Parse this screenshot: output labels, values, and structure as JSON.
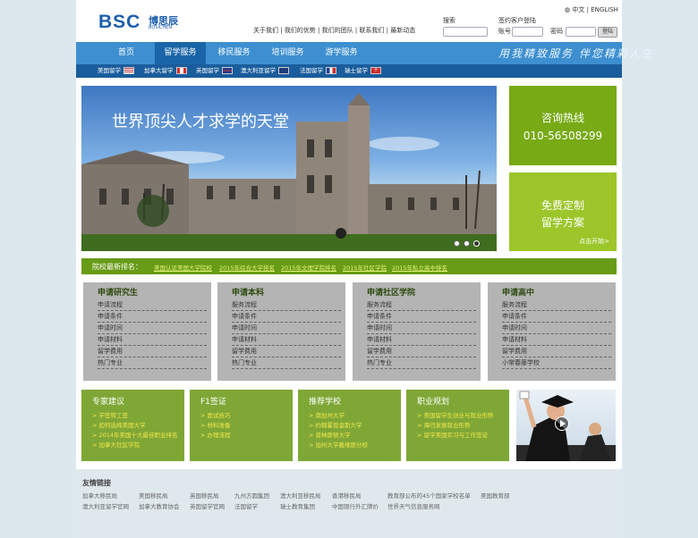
{
  "logo": {
    "mark": "BSC",
    "cn": "博思辰",
    "en": "BOSICHEN"
  },
  "top_links": [
    "关于我们",
    "我们的优势",
    "我们的团队",
    "联系我们",
    "最新动态"
  ],
  "lang": {
    "cn": "中文",
    "sep": "|",
    "en": "ENGLISH"
  },
  "search_label": "搜索",
  "login": {
    "title": "签约客户登陆",
    "account": "账号",
    "password": "密码",
    "button": "登陆"
  },
  "nav": [
    "首页",
    "留学服务",
    "移民服务",
    "培训服务",
    "游学服务"
  ],
  "slogan": "用我精致服务 伴您精彩人生",
  "subnav": [
    "美国留学",
    "加拿大留学",
    "英国留学",
    "澳大利亚留学",
    "法国留学",
    "瑞士留学"
  ],
  "flag_colors": [
    "#bf3a46",
    "#d42a2a",
    "#1d3c8c",
    "#1e3a7a",
    "#1e3c96",
    "#d42a2a"
  ],
  "banner": {
    "title": "世界顶尖人才求学的天堂"
  },
  "hotline": {
    "title": "咨询热线",
    "number": "010-56508299"
  },
  "custom": {
    "line1": "免费定制",
    "line2": "留学方案",
    "cta": "点击开始>"
  },
  "ranking": {
    "title": "院校最新排名：",
    "links": [
      "美国认证美国大学院校",
      "2015年综合大学排名",
      "2015年文理学院排名",
      "2015年社区学院",
      "2015年私立高中排名"
    ]
  },
  "categories": [
    {
      "title": "申请研究生",
      "items": [
        "申请流程",
        "申请条件",
        "申请时间",
        "申请材料",
        "留学费用",
        "热门专业"
      ]
    },
    {
      "title": "申请本科",
      "items": [
        "服务流程",
        "申请条件",
        "申请时间",
        "申请材料",
        "留学费用",
        "热门专业"
      ]
    },
    {
      "title": "申请社区学院",
      "items": [
        "服务流程",
        "申请条件",
        "申请时间",
        "申请材料",
        "留学费用",
        "热门专业"
      ]
    },
    {
      "title": "申请高中",
      "items": [
        "服务流程",
        "申请条件",
        "申请时间",
        "申请材料",
        "留学费用",
        "小常春藤学校"
      ]
    }
  ],
  "panels": [
    {
      "title": "专家建议",
      "items": [
        "> 学签转工签",
        "> 如何选择美国大学",
        "> 2014年美国十大最佳职业排名",
        "> 加拿大社区学院"
      ]
    },
    {
      "title": "F1签证",
      "items": [
        "> 面试技巧",
        "> 材料准备",
        "> 办理流程"
      ]
    },
    {
      "title": "推荐学校",
      "items": [
        "> 南加州大学",
        "> 约翰霍普金斯大学",
        "> 普林斯顿大学",
        "> 加州大学戴维斯分校"
      ]
    },
    {
      "title": "职业规划",
      "items": [
        "> 美国留学生创业与就业形势",
        "> 海归发展就业形势",
        "> 留学美国实习与工作签证"
      ]
    }
  ],
  "friends": {
    "title": "友情链接",
    "row1": [
      "加拿大移民局",
      "美国移民局",
      "英国移民局",
      "九州方圆集团",
      "澳大利亚移民局",
      "香港移民局",
      "教育部公布的45个国家学校名单",
      "美国教育部"
    ],
    "row2": [
      "澳大利亚留学官网",
      "加拿大教育协会",
      "英国留学官网",
      "法国留学",
      "瑞士教育集团",
      "中国银行外汇牌价",
      "世界天气信息服务网"
    ]
  }
}
